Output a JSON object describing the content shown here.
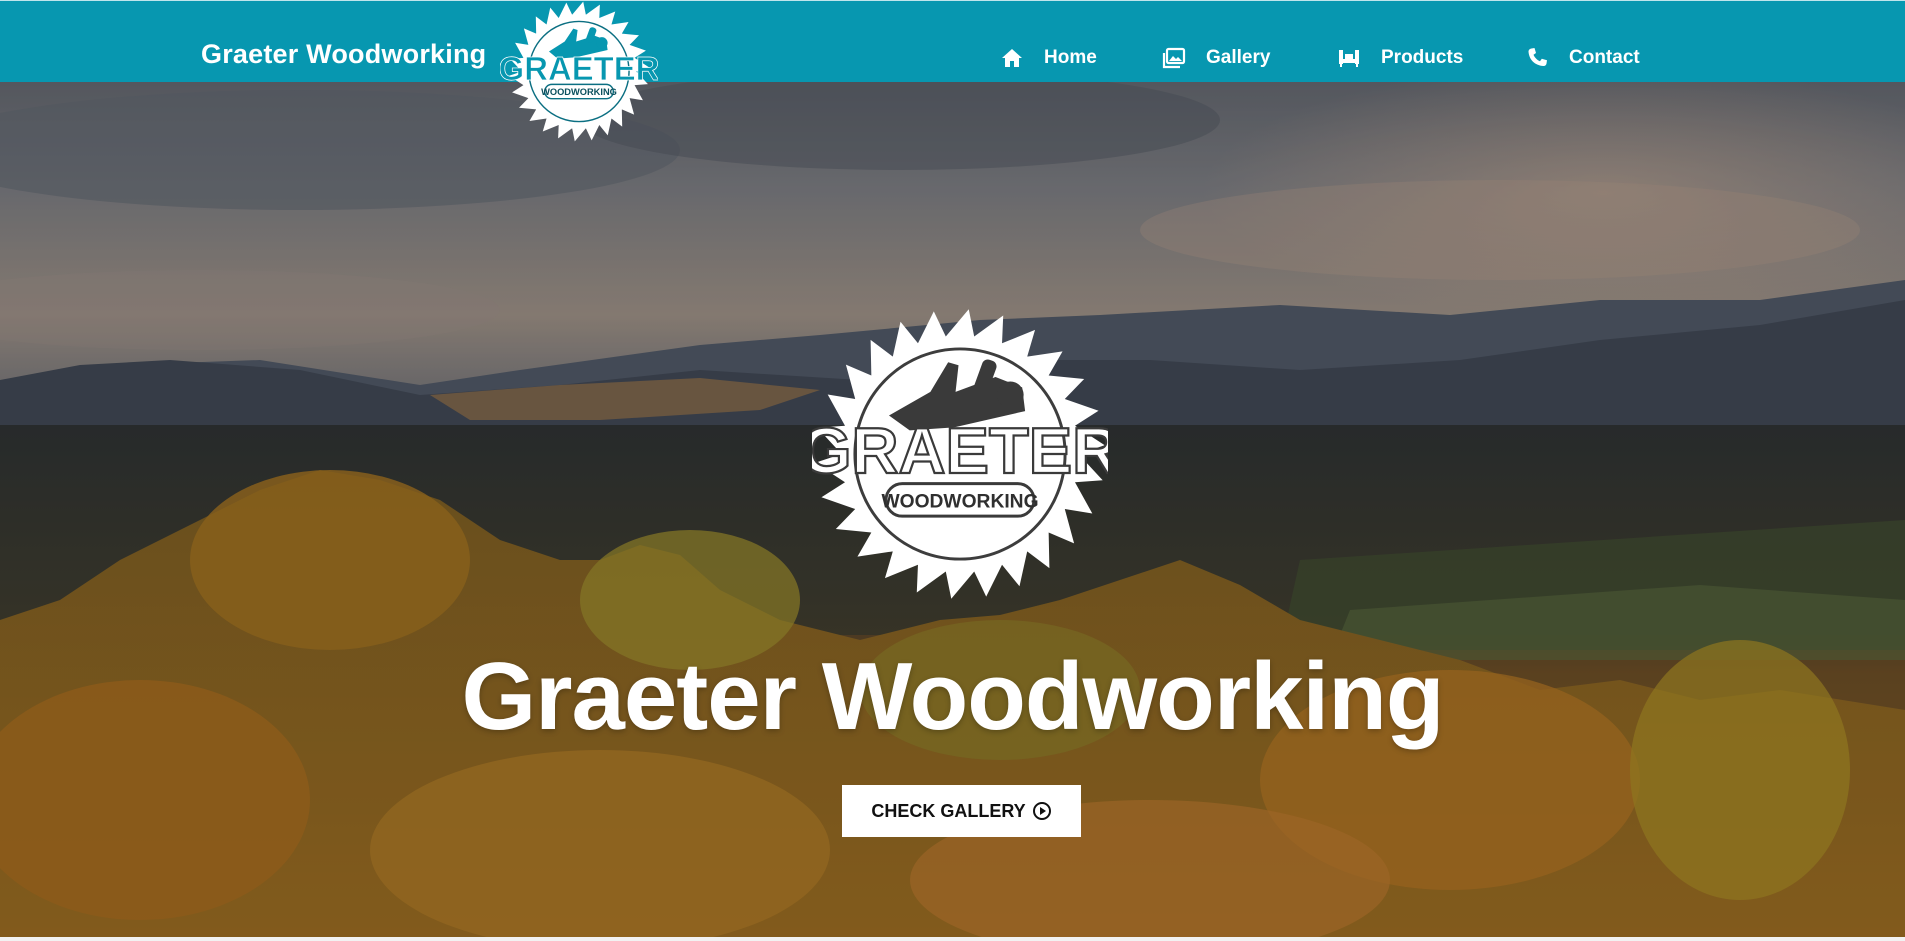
{
  "brand": {
    "name": "Graeter Woodworking",
    "logo_word": "GRAETER",
    "logo_subword": "WOODWORKING",
    "primary_color": "#0797b0"
  },
  "nav": {
    "items": [
      {
        "label": "Home",
        "icon": "home-icon"
      },
      {
        "label": "Gallery",
        "icon": "image-icon"
      },
      {
        "label": "Products",
        "icon": "furniture-icon"
      },
      {
        "label": "Contact",
        "icon": "phone-icon"
      }
    ]
  },
  "hero": {
    "title": "Graeter Woodworking",
    "cta_label": "CHECK GALLERY",
    "cta_icon": "play-circle-icon",
    "background": "autumn forest and mountain landscape"
  }
}
